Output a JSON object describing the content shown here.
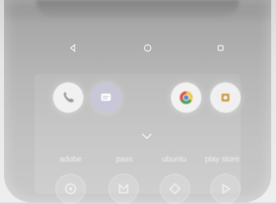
{
  "status": {
    "top_text": ""
  },
  "nav": {
    "back": "back-icon",
    "home": "home-icon",
    "recents": "recents-icon"
  },
  "dock_top": [
    {
      "name": "phone",
      "icon": "phone-icon",
      "bg": "#f1f1f1",
      "fg": "#9a9a9a"
    },
    {
      "name": "messages",
      "icon": "chat-icon",
      "bg": "#c7c7d8",
      "fg": "#ffffff"
    },
    {
      "name": "chrome",
      "icon": "chrome-icon",
      "bg": "#f2f2f2",
      "fg": "#5b8fd1"
    },
    {
      "name": "camera",
      "icon": "camera-icon",
      "bg": "#f0f0f0",
      "fg": "#d2a24a"
    }
  ],
  "app_labels": [
    "adobe",
    "pass",
    "ubuntu",
    "play store"
  ],
  "bottom_icons": [
    {
      "name": "app1",
      "icon": "app-icon"
    },
    {
      "name": "app2",
      "icon": "app-icon"
    },
    {
      "name": "app3",
      "icon": "app-icon"
    },
    {
      "name": "app4",
      "icon": "play-store-icon"
    }
  ]
}
